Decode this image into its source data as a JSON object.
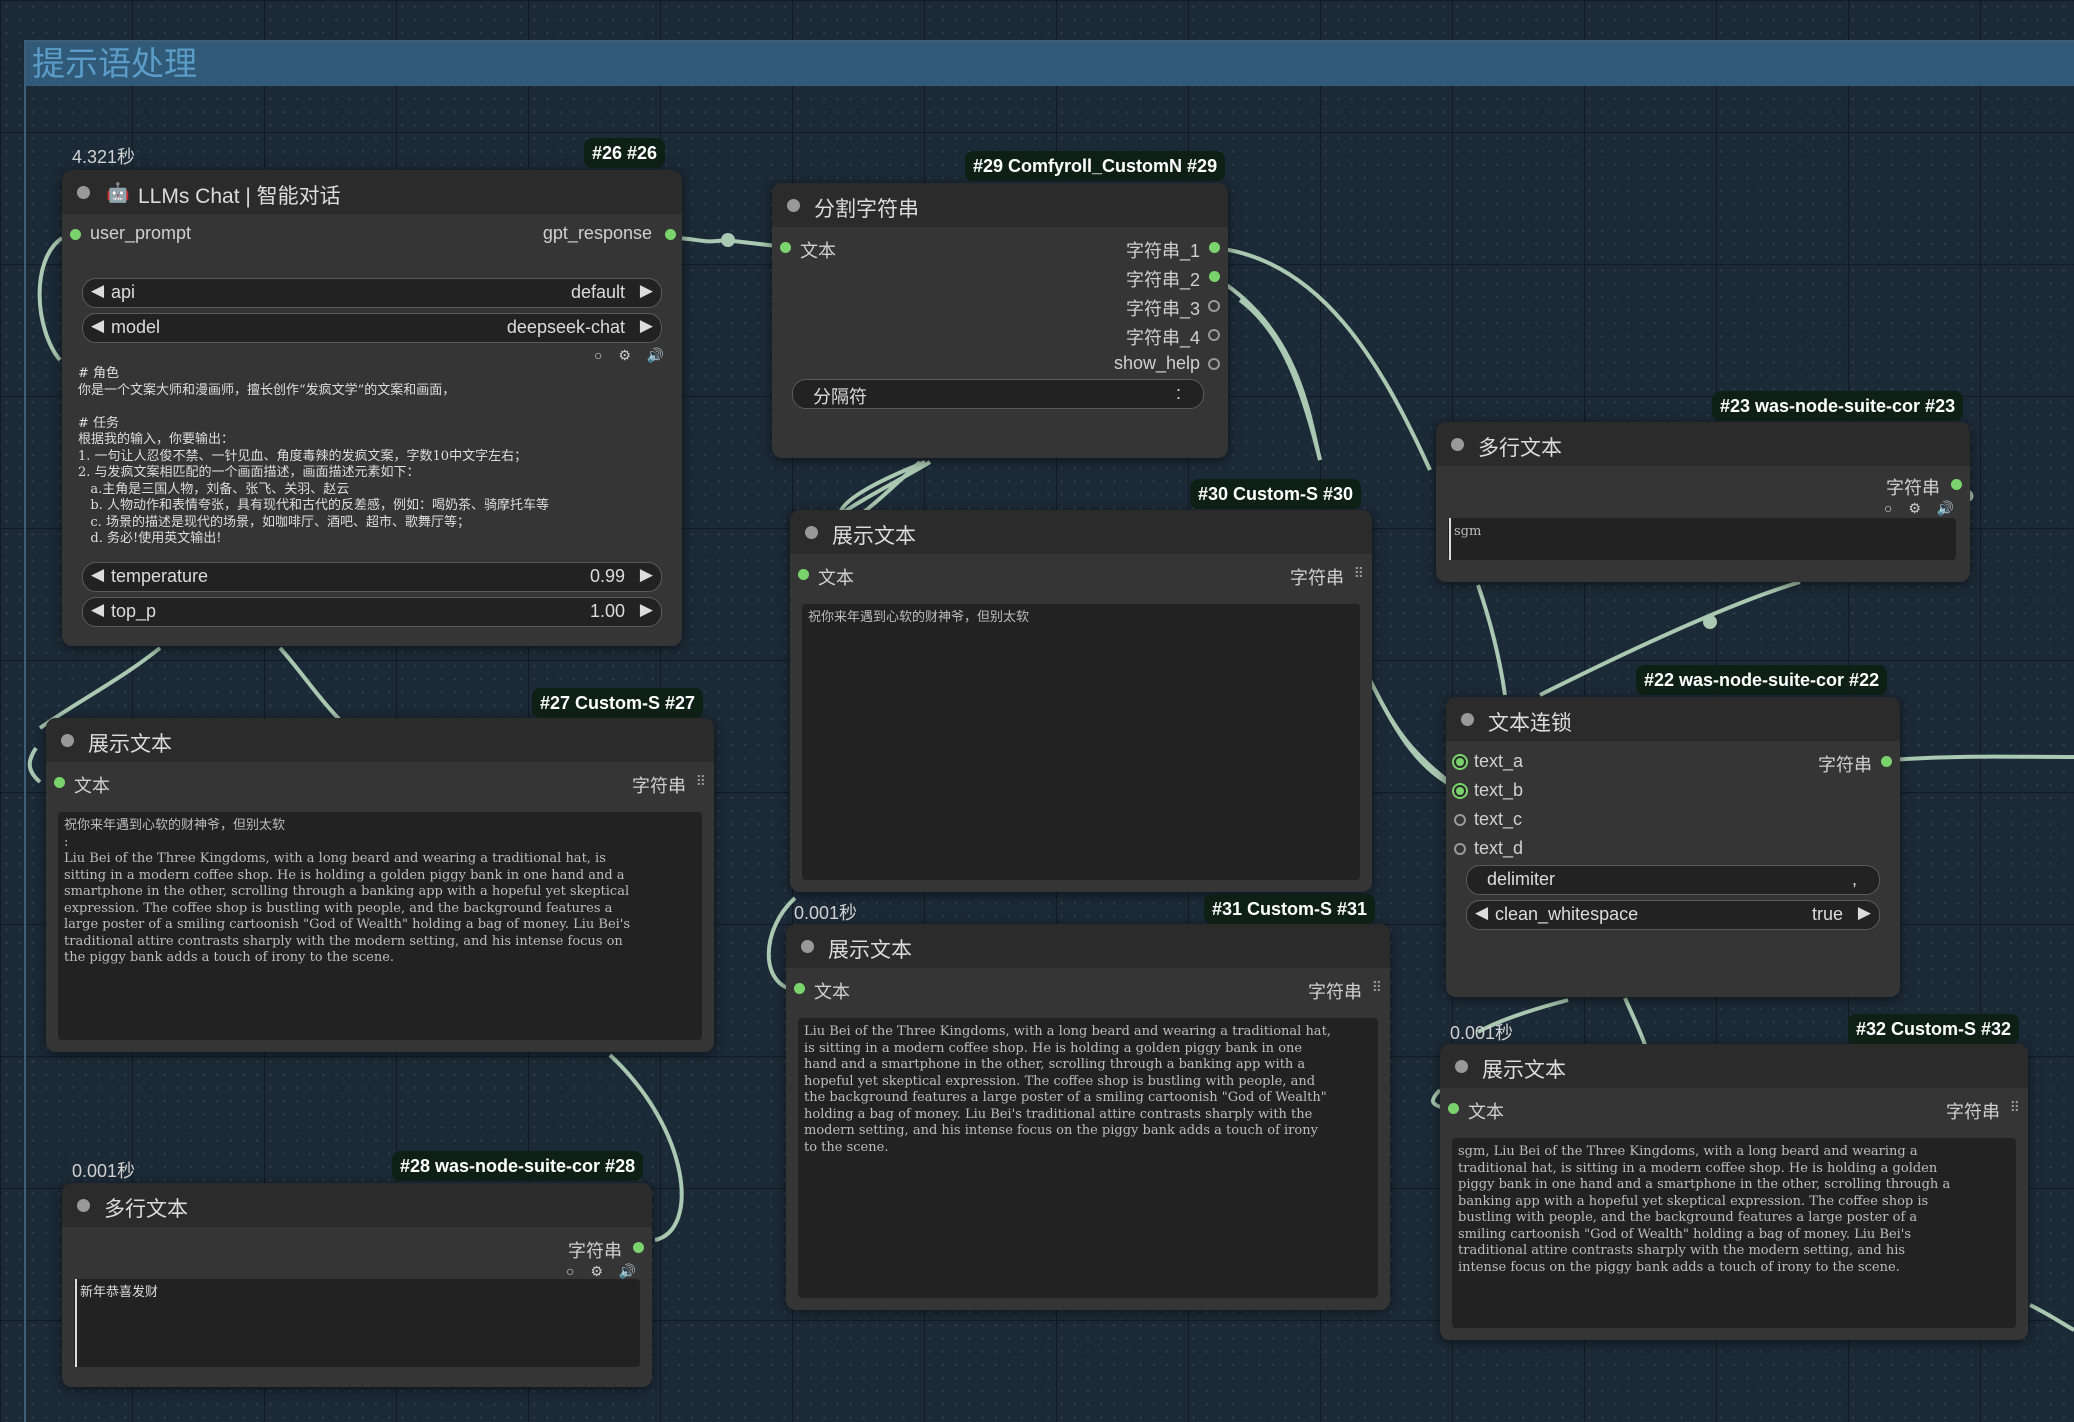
{
  "group": {
    "title": "提示语处理"
  },
  "node26": {
    "timer": "4.321秒",
    "badge": "#26  #26",
    "title": "LLMs Chat | 智能对话",
    "input": "user_prompt",
    "output": "gpt_response",
    "api": {
      "label": "api",
      "value": "default"
    },
    "model": {
      "label": "model",
      "value": "deepseek-chat"
    },
    "prompt": "# 角色\n你是一个文案大师和漫画师，擅长创作“发疯文学”的文案和画面，\n\n# 任务\n根据我的输入，你要输出：\n1. 一句让人忍俊不禁、一针见血、角度毒辣的发疯文案，字数10中文字左右；\n2. 与发疯文案相匹配的一个画面描述，画面描述元素如下：\n   a.主角是三国人物，刘备、张飞、关羽、赵云\n   b. 人物动作和表情夸张，具有现代和古代的反差感，例如：喝奶茶、骑摩托车等\n   c. 场景的描述是现代的场景，如咖啡厅、酒吧、超市、歌舞厅等；\n   d. 务必!使用英文输出!",
    "temperature": {
      "label": "temperature",
      "value": "0.99"
    },
    "top_p": {
      "label": "top_p",
      "value": "1.00"
    }
  },
  "node29": {
    "badge": "#29 Comfyroll_CustomN  #29",
    "title": "分割字符串",
    "input": "文本",
    "outputs": [
      "字符串_1",
      "字符串_2",
      "字符串_3",
      "字符串_4",
      "show_help"
    ],
    "separator": {
      "label": "分隔符",
      "value": ":"
    }
  },
  "node23": {
    "badge": "#23 was-node-suite-cor  #23",
    "title": "多行文本",
    "output": "字符串",
    "text": "sgm"
  },
  "node30": {
    "badge": "#30 Custom-S  #30",
    "title": "展示文本",
    "input": "文本",
    "output": "字符串",
    "text": "祝你来年遇到心软的财神爷，但别太软"
  },
  "node27": {
    "badge": "#27 Custom-S  #27",
    "title": "展示文本",
    "input": "文本",
    "output": "字符串",
    "text": "祝你来年遇到心软的财神爷，但别太软\n:\nLiu Bei of the Three Kingdoms, with a long beard and wearing a traditional hat, is\nsitting in a modern coffee shop. He is holding a golden piggy bank in one hand and a\nsmartphone in the other, scrolling through a banking app with a hopeful yet skeptical\nexpression. The coffee shop is bustling with people, and the background features a\nlarge poster of a smiling cartoonish \"God of Wealth\" holding a bag of money. Liu Bei's\ntraditional attire contrasts sharply with the modern setting, and his intense focus on\nthe piggy bank adds a touch of irony to the scene."
  },
  "node22": {
    "badge": "#22 was-node-suite-cor  #22",
    "title": "文本连锁",
    "inputs": [
      "text_a",
      "text_b",
      "text_c",
      "text_d"
    ],
    "output": "字符串",
    "delimiter": {
      "label": "delimiter",
      "value": ","
    },
    "clean_whitespace": {
      "label": "clean_whitespace",
      "value": "true"
    }
  },
  "node31": {
    "timer": "0.001秒",
    "badge": "#31 Custom-S  #31",
    "title": "展示文本",
    "input": "文本",
    "output": "字符串",
    "text": "Liu Bei of the Three Kingdoms, with a long beard and wearing a traditional hat,\nis sitting in a modern coffee shop. He is holding a golden piggy bank in one\nhand and a smartphone in the other, scrolling through a banking app with a\nhopeful yet skeptical expression. The coffee shop is bustling with people, and\nthe background features a large poster of a smiling cartoonish \"God of Wealth\"\nholding a bag of money. Liu Bei's traditional attire contrasts sharply with the\nmodern setting, and his intense focus on the piggy bank adds a touch of irony\nto the scene."
  },
  "node28": {
    "timer": "0.001秒",
    "badge": "#28 was-node-suite-cor  #28",
    "title": "多行文本",
    "output": "字符串",
    "text": "新年恭喜发财"
  },
  "node32": {
    "timer": "0.001秒",
    "badge": "#32 Custom-S  #32",
    "title": "展示文本",
    "input": "文本",
    "output": "字符串",
    "text": "sgm, Liu Bei of the Three Kingdoms, with a long beard and wearing a\ntraditional hat, is sitting in a modern coffee shop. He is holding a golden\npiggy bank in one hand and a smartphone in the other, scrolling through a\nbanking app with a hopeful yet skeptical expression. The coffee shop is\nbustling with people, and the background features a large poster of a\nsmiling cartoonish \"God of Wealth\" holding a bag of money. Liu Bei's\ntraditional attire contrasts sharply with the modern setting, and his\nintense focus on the piggy bank adds a touch of irony to the scene."
  },
  "colors": {
    "link": "#a9c9b2",
    "socket_active": "#7bd36d",
    "group_header": "#305a77",
    "group_title": "#5b9cc8",
    "node_body": "#353535",
    "badge_bg": "#0e2016"
  },
  "icons": {
    "widget_left": "◀",
    "widget_right": "▶",
    "toolbar": "○ ⚙ 🔊",
    "grip": "⠿"
  }
}
